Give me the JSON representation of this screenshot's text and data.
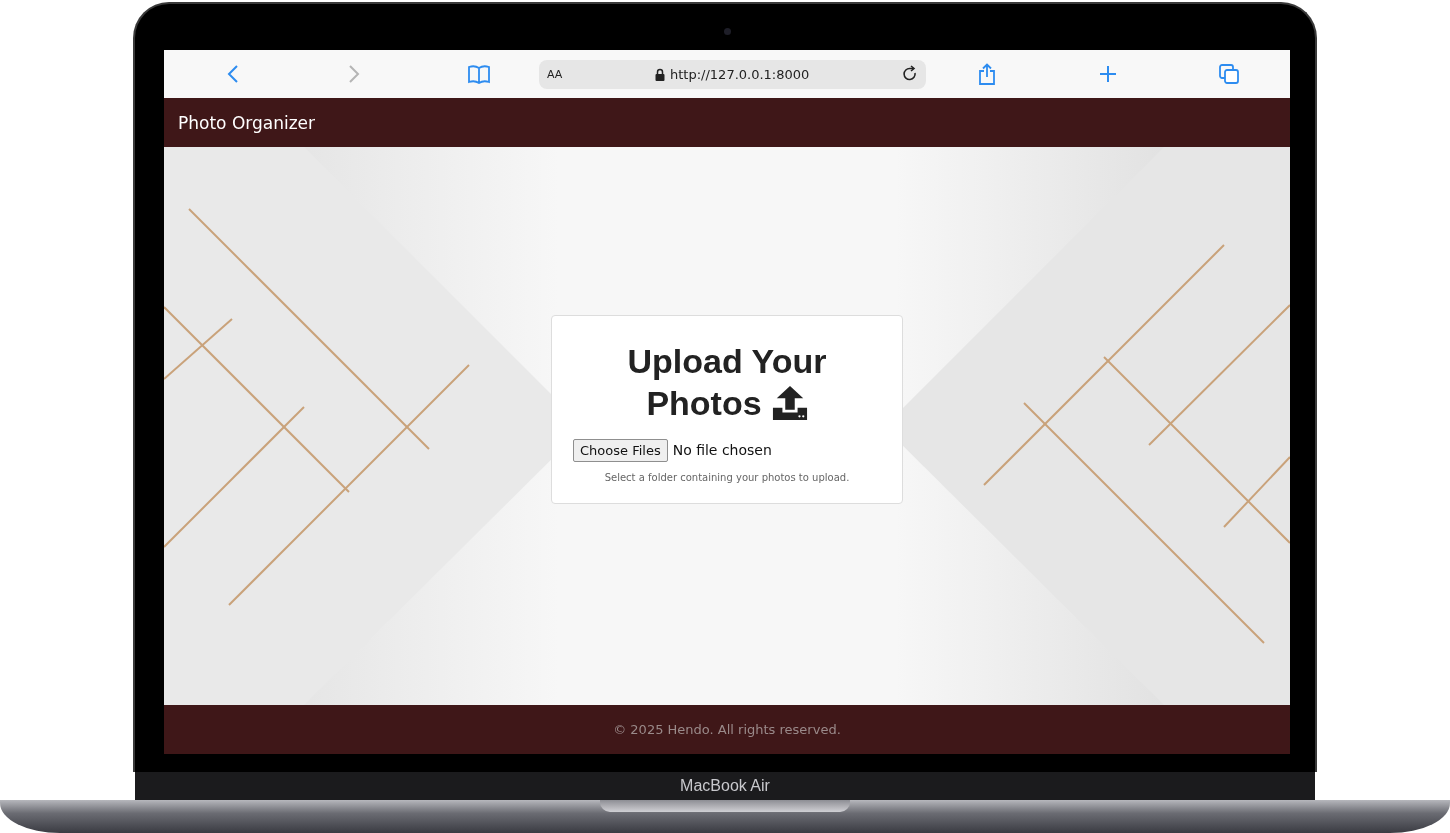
{
  "browser": {
    "back_disabled": false,
    "forward_disabled": true,
    "reader_label": "AA",
    "url": "http://127.0.0.1:8000"
  },
  "navbar": {
    "brand": "Photo Organizer"
  },
  "upload_card": {
    "title_lines": [
      "Upload Your",
      "Photos"
    ],
    "file_button": "Choose Files",
    "file_status": "No file chosen",
    "help_text": "Select a folder containing your photos to upload."
  },
  "footer": {
    "text": "© 2025 Hendo. All rights reserved."
  },
  "device": {
    "label": "MacBook Air"
  }
}
